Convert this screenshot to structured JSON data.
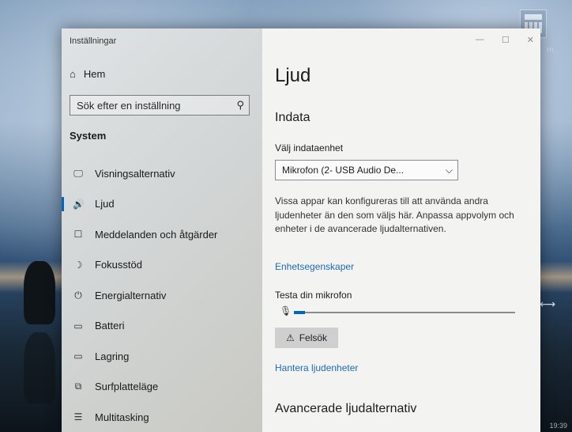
{
  "window": {
    "app_title": "Inställningar",
    "controls": {
      "minimize": "—",
      "maximize": "☐",
      "close": "✕"
    }
  },
  "sidebar": {
    "home_label": "Hem",
    "search_placeholder": "Sök efter en inställning",
    "section_label": "System",
    "items": [
      {
        "label": "Visningsalternativ",
        "icon": "display-icon",
        "glyph": "🖵",
        "active": false
      },
      {
        "label": "Ljud",
        "icon": "speaker-icon",
        "glyph": "🔊",
        "active": true
      },
      {
        "label": "Meddelanden och åtgärder",
        "icon": "notification-icon",
        "glyph": "☐",
        "active": false
      },
      {
        "label": "Fokusstöd",
        "icon": "moon-icon",
        "glyph": "☽",
        "active": false
      },
      {
        "label": "Energialternativ",
        "icon": "power-icon",
        "glyph": "⏻",
        "active": false
      },
      {
        "label": "Batteri",
        "icon": "battery-icon",
        "glyph": "▭",
        "active": false
      },
      {
        "label": "Lagring",
        "icon": "storage-icon",
        "glyph": "▭",
        "active": false
      },
      {
        "label": "Surfplatteläge",
        "icon": "tablet-icon",
        "glyph": "⧉",
        "active": false
      },
      {
        "label": "Multitasking",
        "icon": "multitasking-icon",
        "glyph": "☰",
        "active": false
      }
    ]
  },
  "content": {
    "page_title": "Ljud",
    "input_heading": "Indata",
    "choose_input_label": "Välj indataenhet",
    "input_device": "Mikrofon (2- USB Audio De...",
    "info_text": "Vissa appar kan konfigureras till att använda andra ljudenheter än den som väljs här. Anpassa appvolym och enheter i de avancerade ljudalternativen.",
    "device_properties_link": "Enhetsegenskaper",
    "test_mic_label": "Testa din mikrofon",
    "mic_level_percent": 5,
    "troubleshoot_label": "Felsök",
    "manage_devices_link": "Hantera ljudenheter",
    "advanced_heading": "Avancerade ljudalternativ"
  },
  "desktop": {
    "clock": "19:39",
    "edge_text": "rn"
  },
  "colors": {
    "accent": "#0067c0",
    "link": "#1b6bb8"
  }
}
